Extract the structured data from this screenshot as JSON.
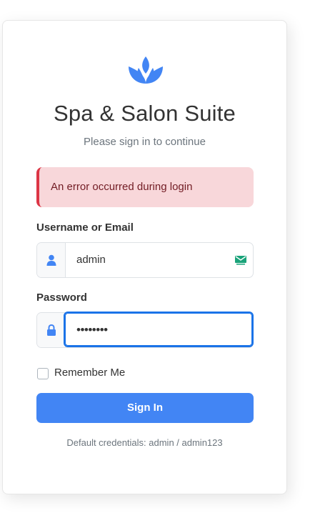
{
  "app": {
    "title": "Spa & Salon Suite",
    "subtitle": "Please sign in to continue",
    "logo_icon": "spa-lotus-icon"
  },
  "alert": {
    "message": "An error occurred during login"
  },
  "form": {
    "username_label": "Username or Email",
    "username_value": "admin",
    "username_icon": "user-icon",
    "password_label": "Password",
    "password_value": "••••••••",
    "password_icon": "lock-icon",
    "remember_label": "Remember Me",
    "remember_checked": false,
    "submit_label": "Sign In"
  },
  "footer": {
    "credentials_hint": "Default credentials: admin / admin123"
  },
  "colors": {
    "primary": "#4285f4",
    "alert_bg": "#f8d7da",
    "alert_border": "#dc3545",
    "alert_text": "#721c24",
    "focus_ring": "#1a73e8"
  }
}
